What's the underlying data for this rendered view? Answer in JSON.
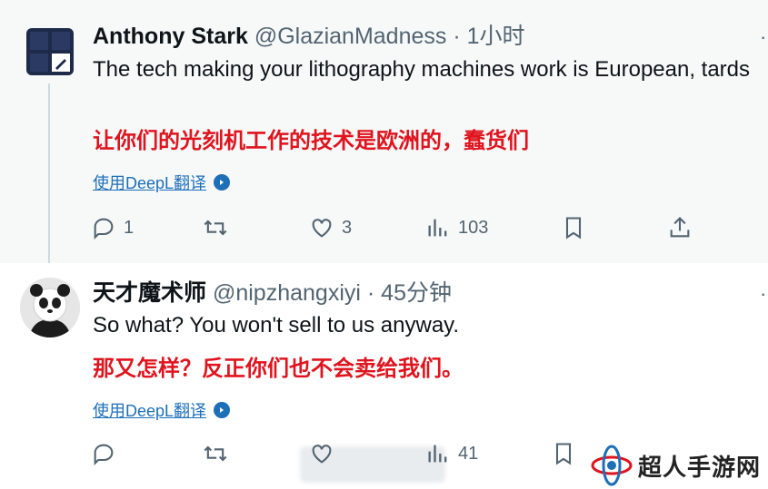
{
  "tweets": [
    {
      "name": "Anthony Stark",
      "handle": "@GlazianMadness",
      "separator": "·",
      "time": "1小时",
      "text": "The tech making your lithography machines work is European, tards",
      "translation_zh": "让你们的光刻机工作的技术是欧洲的，蠢货们",
      "translate_link": "使用DeepL翻译",
      "counts": {
        "reply": "1",
        "retweet": "",
        "like": "3",
        "views": "103"
      }
    },
    {
      "name": "天才魔术师",
      "handle": "@nipzhangxiyi",
      "separator": "·",
      "time": "45分钟",
      "text": "So what? You won't sell to us anyway.",
      "translation_zh": "那又怎样？反正你们也不会卖给我们。",
      "translate_link": "使用DeepL翻译",
      "counts": {
        "reply": "",
        "retweet": "",
        "like": "",
        "views": "41"
      }
    }
  ],
  "more_label": "·",
  "watermark": {
    "text": "超人手游网"
  },
  "colors": {
    "accent": "#1d6fb8",
    "translation": "#e0141e",
    "muted": "#536471"
  }
}
